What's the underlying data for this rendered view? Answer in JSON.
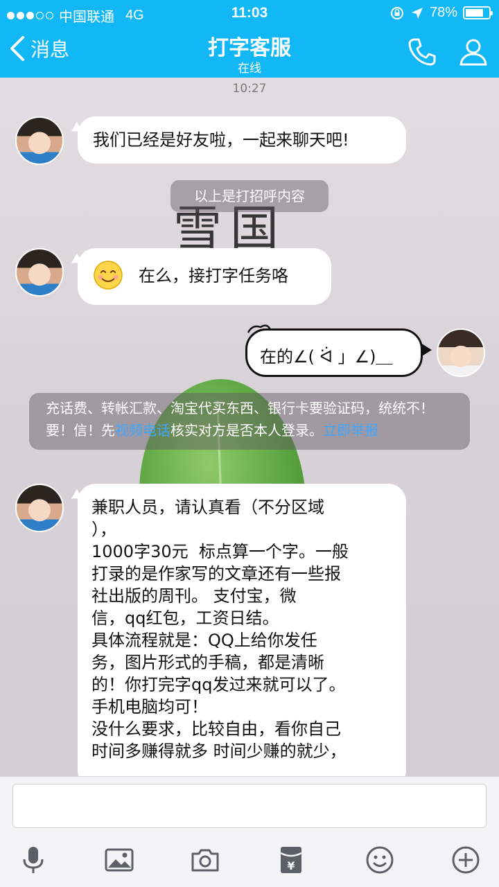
{
  "status_bar": {
    "carrier": "中国联通",
    "network": "4G",
    "time": "11:03",
    "battery": "78%",
    "battery_level": 0.78
  },
  "nav": {
    "back_label": "消息",
    "title": "打字客服",
    "subtitle": "在线"
  },
  "chat": {
    "timestamp": "10:27",
    "messages": [
      {
        "text": "我们已经是好友啦，一起来聊天吧!"
      },
      {
        "text": "在么，接打字任务咯"
      },
      {
        "text": "兼职人员，请认真看（不分区域\n），\n1000字30元  标点算一个字。一般\n打录的是作家写的文章还有一些报\n社出版的周刊。 支付宝，微\n信，qq红包，工资日结。\n具体流程就是：QQ上给你发任\n务，图片形式的手稿，都是清晰\n的！你打完字qq发过来就可以了。\n手机电脑均可！\n没什么要求，比较自由，看你自己\n时间多赚得就多 时间少赚的就少，"
      }
    ],
    "greeting_notice": "以上是打招呼内容",
    "my_message": "在的∠( ᐛ 」∠)＿",
    "warning": {
      "text_1": "充话费、转帐汇款、淘宝代买东西、银行卡要验证码，统统不！要！信！先",
      "link_video": "视频电话",
      "text_2": "核实对方是否本人登录。",
      "link_report": "立即举报"
    }
  },
  "background": {
    "calligraphy": "雪国"
  },
  "input": {
    "value": ""
  },
  "colors": {
    "accent": "#12b7f5",
    "link": "#3fa7ff"
  },
  "icons": {
    "toolbar": [
      "microphone-icon",
      "image-icon",
      "camera-icon",
      "red-packet-icon",
      "emoji-icon",
      "plus-icon"
    ]
  }
}
